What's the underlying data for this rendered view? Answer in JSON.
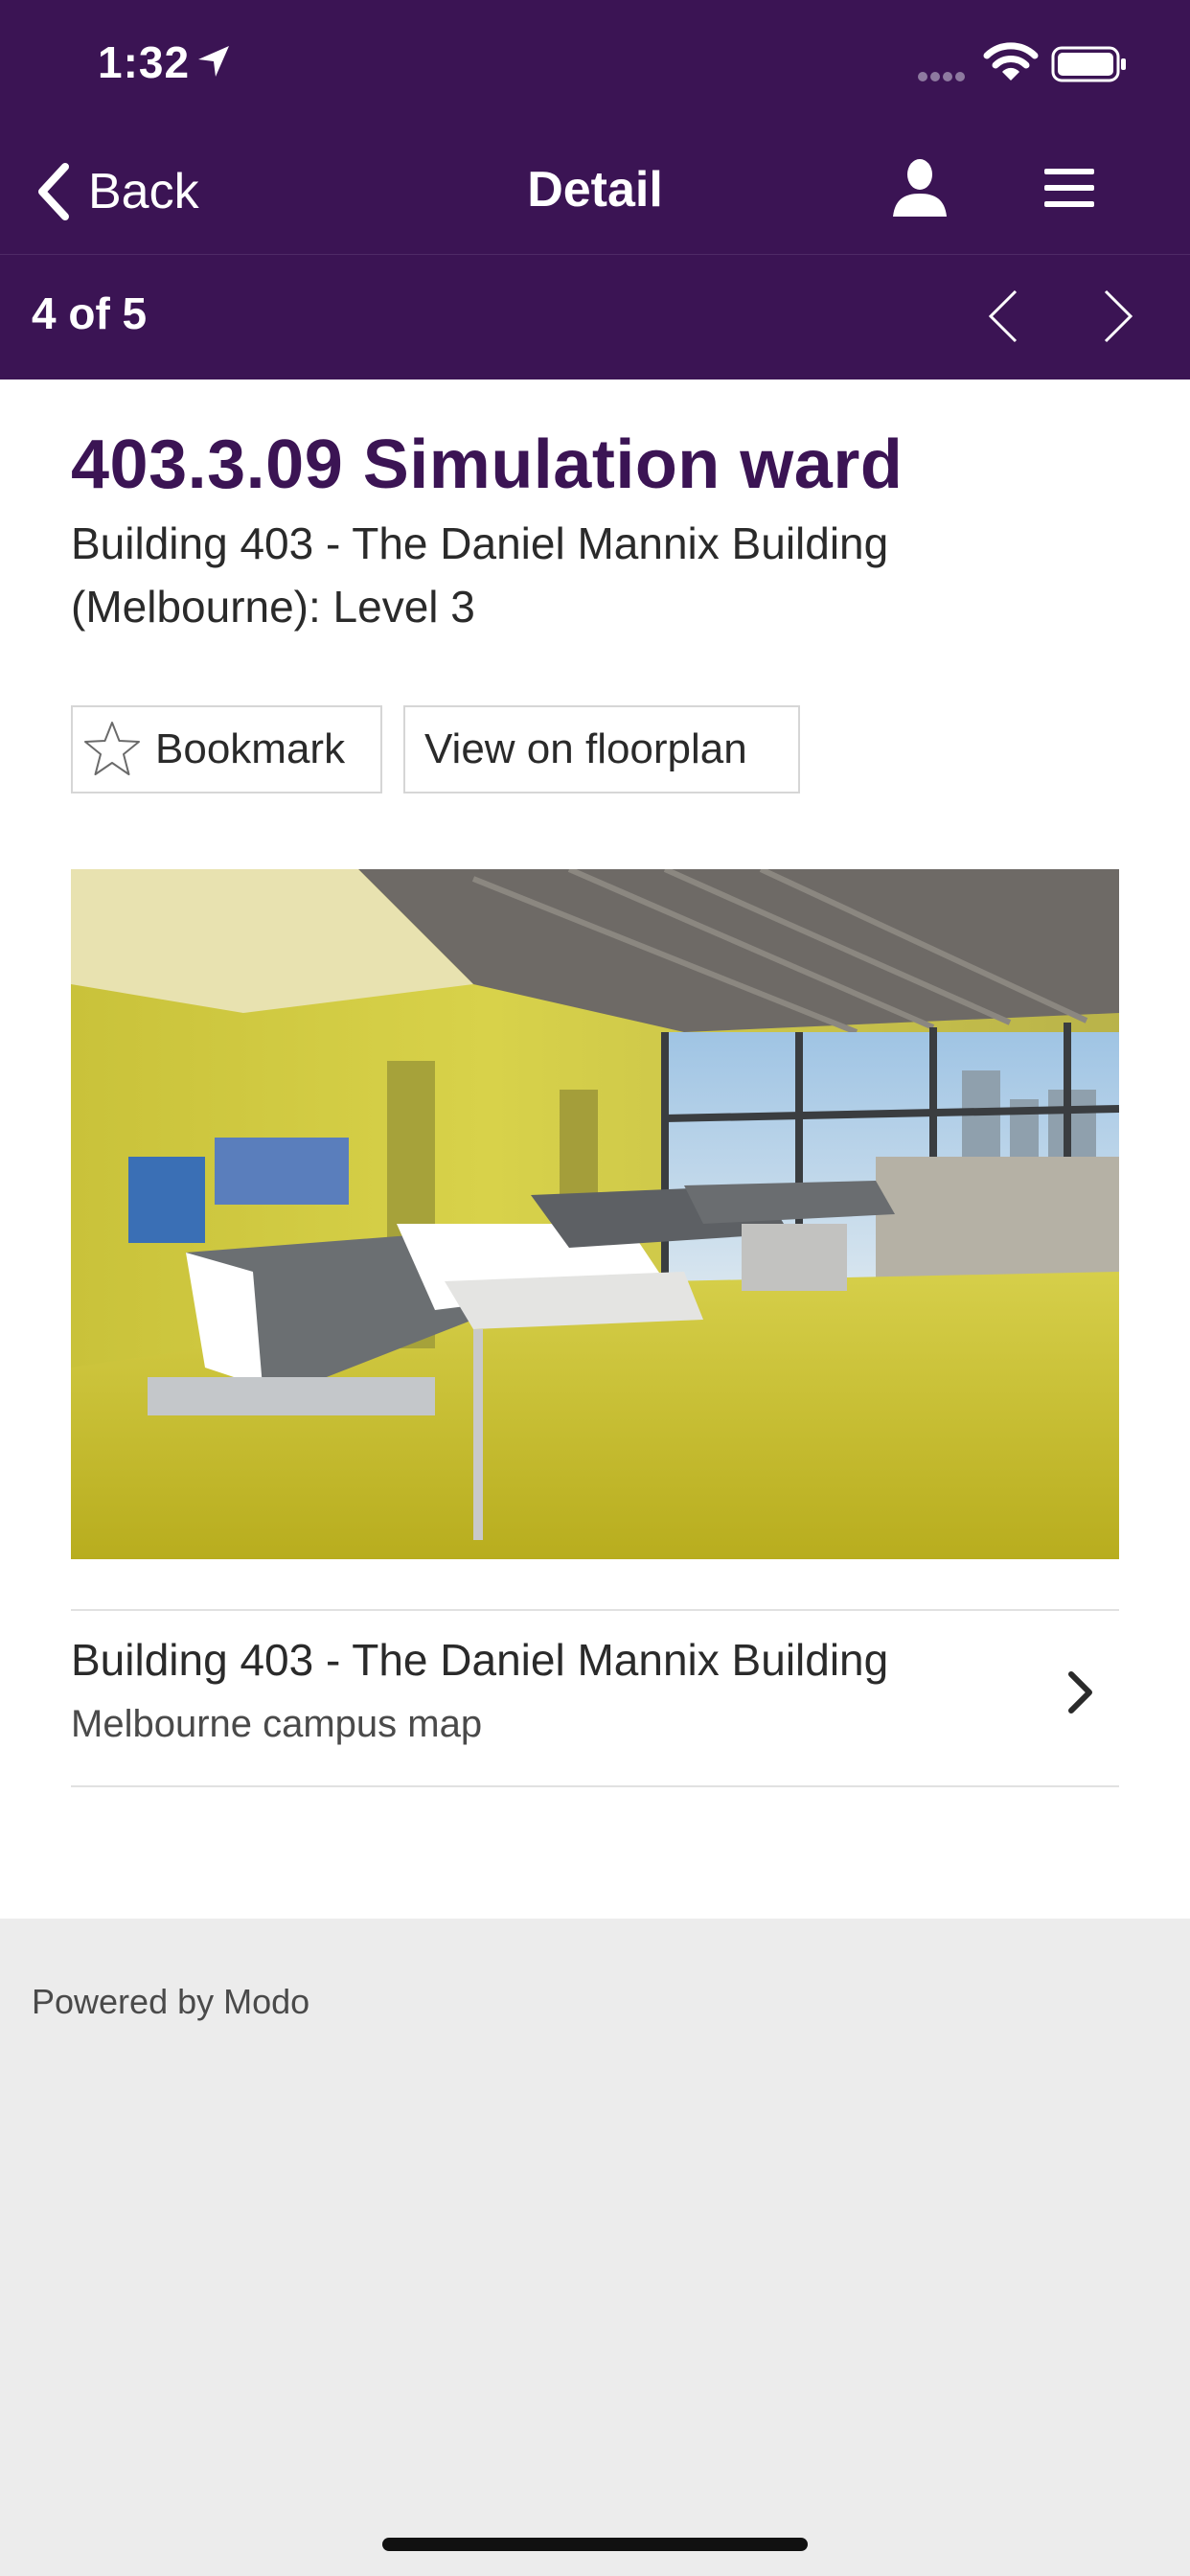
{
  "status_bar": {
    "time": "1:32"
  },
  "nav": {
    "back_label": "Back",
    "title": "Detail",
    "icons": [
      "location-arrow-icon",
      "signal-icon",
      "wifi-icon",
      "battery-icon",
      "chevron-left-icon",
      "person-icon",
      "hamburger-menu-icon"
    ]
  },
  "pager": {
    "count_label": "4 of 5"
  },
  "detail": {
    "title": "403.3.09 Simulation ward",
    "subtitle": "Building 403 - The Daniel Mannix Building (Melbourne): Level 3",
    "bookmark_label": "Bookmark",
    "floorplan_label": "View on floorplan"
  },
  "related_link": {
    "title": "Building 403 - The Daniel Mannix Building",
    "subtitle": "Melbourne campus map"
  },
  "footer": {
    "text": "Powered by Modo"
  },
  "colors": {
    "brand_purple": "#3b1454",
    "background": "#ececec"
  }
}
